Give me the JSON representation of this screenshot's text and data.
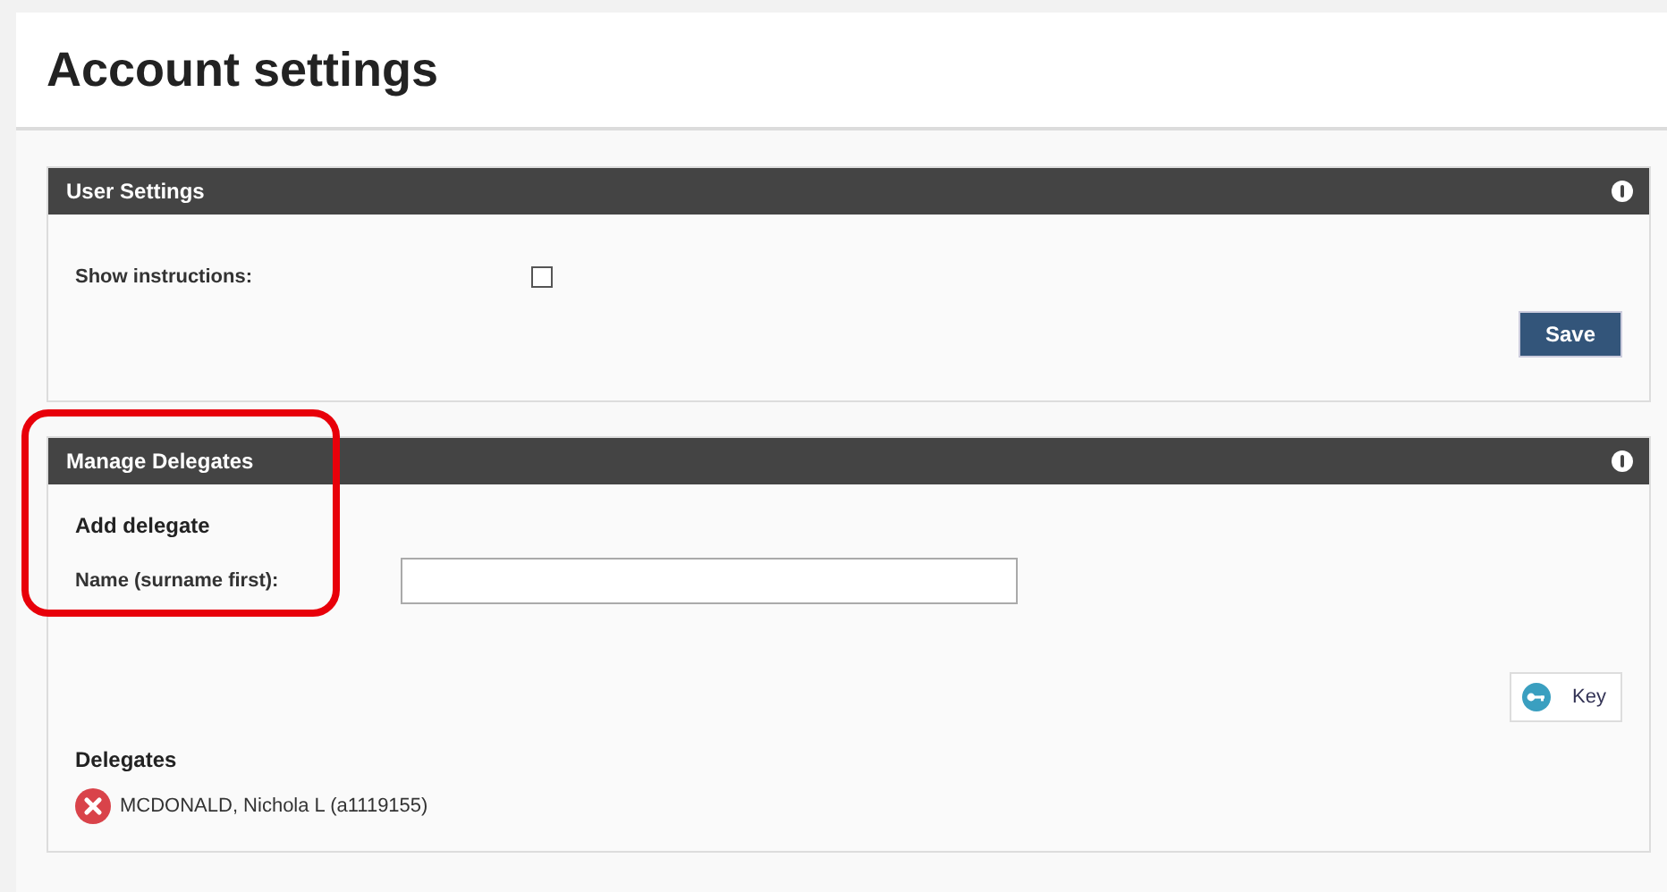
{
  "page": {
    "title": "Account settings"
  },
  "user_settings": {
    "title": "User Settings",
    "fields": [
      {
        "label": "Show instructions:",
        "kind": "checkbox",
        "checked": false
      }
    ],
    "save_button": "Save"
  },
  "manage_delegates": {
    "title": "Manage Delegates",
    "add_heading": "Add delegate",
    "name_label": "Name (surname first):",
    "highlighted": true,
    "key_button": "Key",
    "delegates_heading": "Delegates",
    "delegates": [
      {
        "name": "MCDONALD, Nichola L (a1119155)"
      }
    ]
  }
}
